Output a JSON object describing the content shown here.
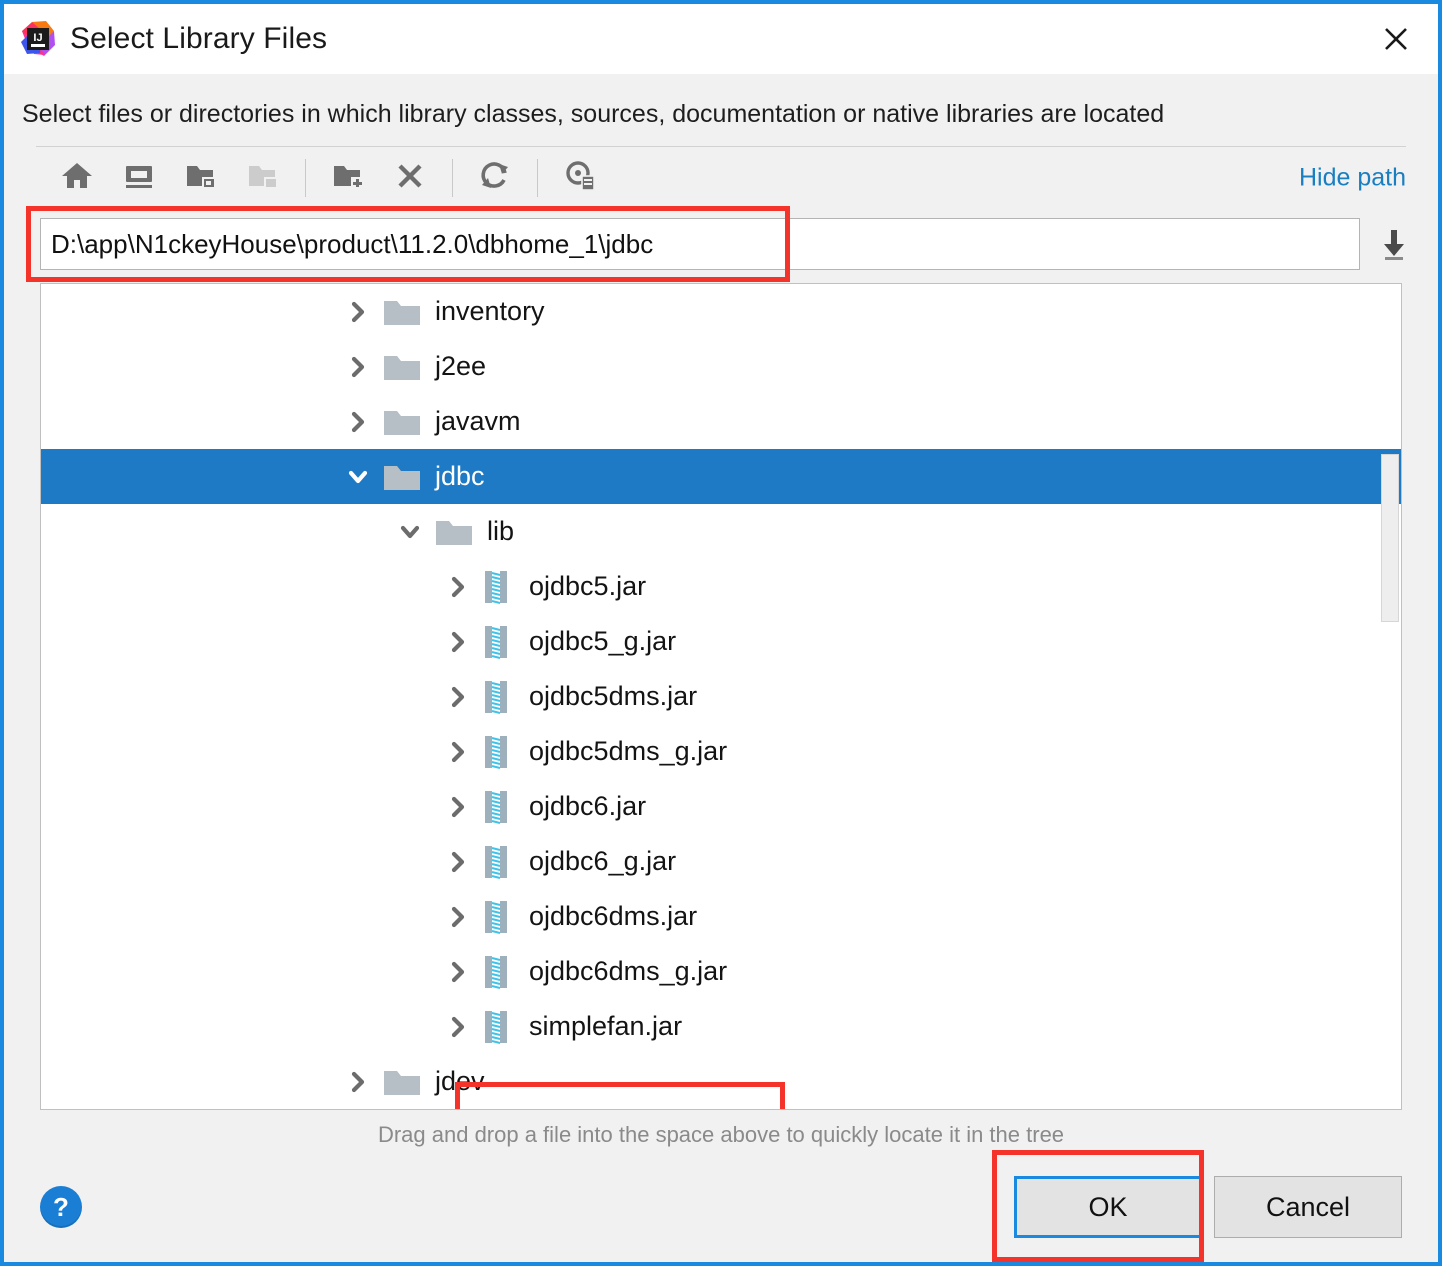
{
  "window": {
    "title": "Select Library Files",
    "app_icon": "intellij-idea-icon",
    "close_icon": "close-icon",
    "accent_color": "#1a8ae0",
    "annotation_color": "#f4332a"
  },
  "subtitle": "Select files or directories in which library classes, sources, documentation or native libraries are located",
  "toolbar": {
    "buttons": [
      {
        "icon": "home-icon",
        "name": "home-button",
        "title": "Home",
        "disabled": false
      },
      {
        "icon": "desktop-icon",
        "name": "desktop-button",
        "title": "Desktop",
        "disabled": false
      },
      {
        "icon": "drive-folder-icon",
        "name": "project-dir-button",
        "title": "Project Directory",
        "disabled": false
      },
      {
        "icon": "folder-up-icon",
        "name": "hide-folder-button",
        "title": "Hide path",
        "disabled": true
      }
    ],
    "buttons2": [
      {
        "icon": "new-folder-icon",
        "name": "new-folder-button",
        "title": "New Folder",
        "disabled": false
      },
      {
        "icon": "delete-x-icon",
        "name": "delete-button",
        "title": "Delete",
        "disabled": false
      }
    ],
    "buttons3": [
      {
        "icon": "refresh-icon",
        "name": "refresh-button",
        "title": "Refresh",
        "disabled": false
      }
    ],
    "buttons4": [
      {
        "icon": "locate-file-icon",
        "name": "locate-file-button",
        "title": "Locate file",
        "disabled": false
      }
    ],
    "hide_path_label": "Hide path"
  },
  "path": {
    "value": "D:\\app\\N1ckeyHouse\\product\\11.2.0\\dbhome_1\\jdbc",
    "placeholder": "",
    "download_icon": "download-arrow-icon",
    "annotated": true
  },
  "tree": {
    "rows": [
      {
        "label": "inventory",
        "type": "folder",
        "depth": 0,
        "twisty": "collapsed",
        "selected": false
      },
      {
        "label": "j2ee",
        "type": "folder",
        "depth": 0,
        "twisty": "collapsed",
        "selected": false
      },
      {
        "label": "javavm",
        "type": "folder",
        "depth": 0,
        "twisty": "collapsed",
        "selected": false
      },
      {
        "label": "jdbc",
        "type": "folder",
        "depth": 0,
        "twisty": "expanded",
        "selected": true
      },
      {
        "label": "lib",
        "type": "folder",
        "depth": 1,
        "twisty": "expanded",
        "selected": false
      },
      {
        "label": "ojdbc5.jar",
        "type": "jar",
        "depth": 2,
        "twisty": "collapsed",
        "selected": false
      },
      {
        "label": "ojdbc5_g.jar",
        "type": "jar",
        "depth": 2,
        "twisty": "collapsed",
        "selected": false
      },
      {
        "label": "ojdbc5dms.jar",
        "type": "jar",
        "depth": 2,
        "twisty": "collapsed",
        "selected": false
      },
      {
        "label": "ojdbc5dms_g.jar",
        "type": "jar",
        "depth": 2,
        "twisty": "collapsed",
        "selected": false
      },
      {
        "label": "ojdbc6.jar",
        "type": "jar",
        "depth": 2,
        "twisty": "collapsed",
        "selected": false,
        "annotated": true
      },
      {
        "label": "ojdbc6_g.jar",
        "type": "jar",
        "depth": 2,
        "twisty": "collapsed",
        "selected": false
      },
      {
        "label": "ojdbc6dms.jar",
        "type": "jar",
        "depth": 2,
        "twisty": "collapsed",
        "selected": false
      },
      {
        "label": "ojdbc6dms_g.jar",
        "type": "jar",
        "depth": 2,
        "twisty": "collapsed",
        "selected": false
      },
      {
        "label": "simplefan.jar",
        "type": "jar",
        "depth": 2,
        "twisty": "collapsed",
        "selected": false
      },
      {
        "label": "jdev",
        "type": "folder",
        "depth": 0,
        "twisty": "collapsed",
        "selected": false
      }
    ],
    "selection_color": "#1e7ac4",
    "scrollbar": "vertical-scrollbar"
  },
  "hint": "Drag and drop a file into the space above to quickly locate it in the tree",
  "footer": {
    "help_label": "?",
    "ok_label": "OK",
    "cancel_label": "Cancel",
    "ok_focused": true,
    "ok_annotated": true
  }
}
